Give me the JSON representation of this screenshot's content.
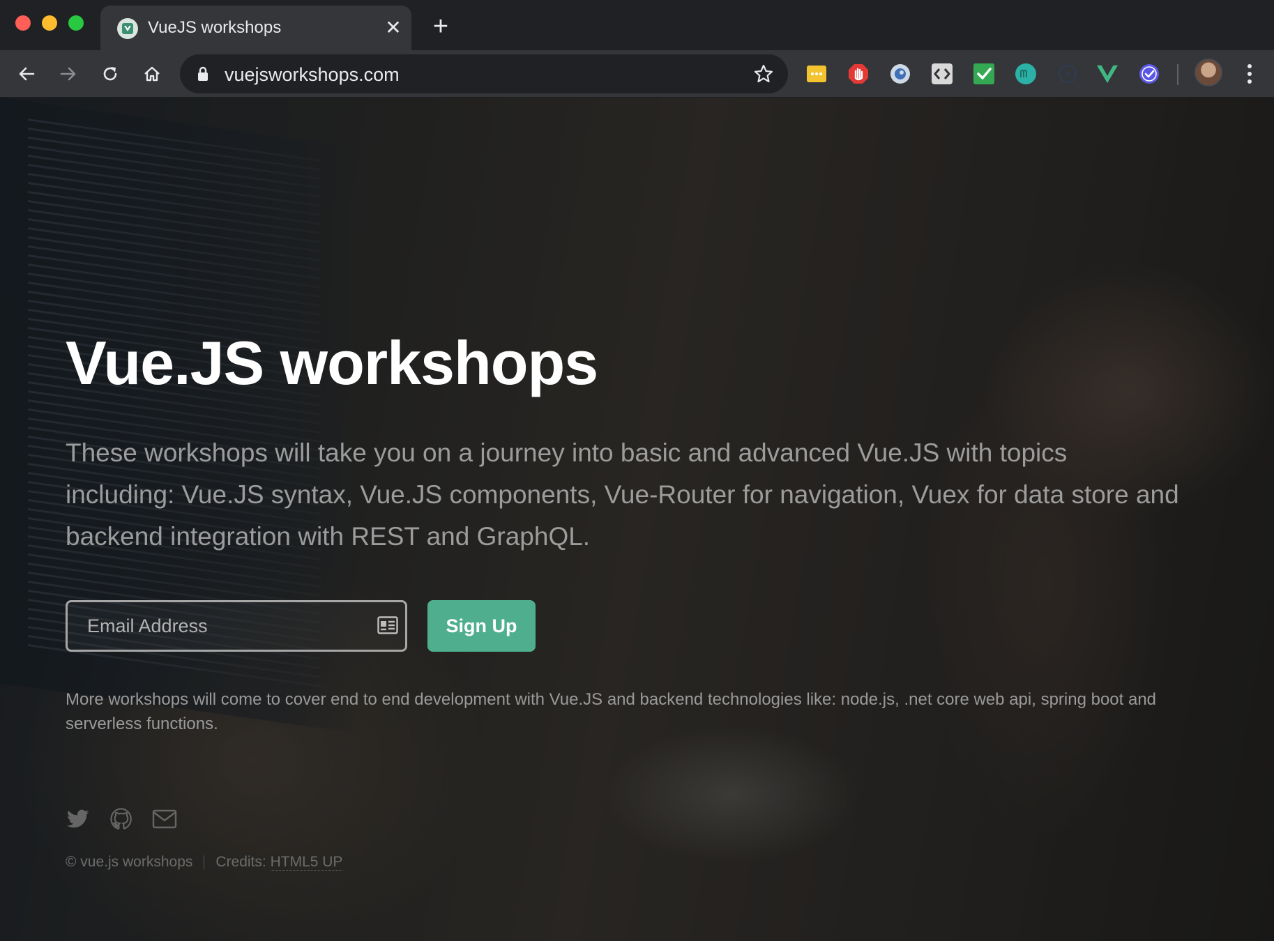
{
  "browser": {
    "tab": {
      "title": "VueJS workshops",
      "close_glyph": "✕",
      "favicon": "vue-favicon-icon"
    },
    "new_tab_glyph": "+",
    "address_bar": {
      "url": "vuejsworkshops.com"
    },
    "extensions": [
      {
        "name": "sticky-notes-extension-icon",
        "color": "#f4c430"
      },
      {
        "name": "adblock-extension-icon",
        "color": "#e53935"
      },
      {
        "name": "circle-extension-icon",
        "color": "#9fb4d8"
      },
      {
        "name": "code-extension-icon",
        "color": "#d0d0d0"
      },
      {
        "name": "check-extension-icon",
        "color": "#34a853"
      },
      {
        "name": "teal-m-extension-icon",
        "color": "#2bb1a6"
      },
      {
        "name": "dark-a-extension-icon",
        "color": "#3a4a6a"
      },
      {
        "name": "vue-devtools-extension-icon",
        "color": "#41b883"
      },
      {
        "name": "checkmark-badge-extension-icon",
        "color": "#6c63ff"
      }
    ]
  },
  "page": {
    "headline": "Vue.JS workshops",
    "intro": "These workshops will take you on a journey into basic and advanced Vue.JS with topics including: Vue.JS syntax, Vue.JS components, Vue-Router for navigation, Vuex for data store and backend integration with REST and GraphQL.",
    "signup_form": {
      "email_placeholder": "Email Address",
      "email_value": "",
      "submit_label": "Sign Up"
    },
    "more_text": "More workshops will come to cover end to end development with Vue.JS and backend technologies like: node.js, .net core web api, spring boot and serverless functions.",
    "social": [
      "twitter-icon",
      "github-icon",
      "email-icon"
    ],
    "footer": {
      "copyright": "© vue.js workshops",
      "credits_label": "Credits: ",
      "credits_link": "HTML5 UP"
    },
    "colors": {
      "accent": "#4fae8e",
      "headline": "#ffffff",
      "body_text": "#9c9c9c"
    }
  }
}
